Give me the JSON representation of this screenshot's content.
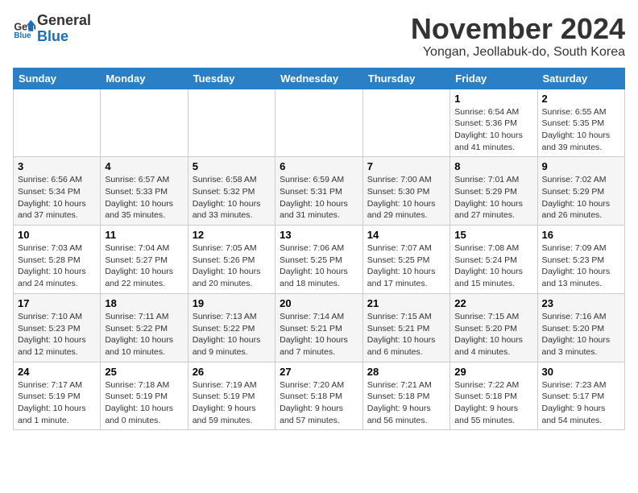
{
  "header": {
    "logo_line1": "General",
    "logo_line2": "Blue",
    "month_year": "November 2024",
    "location": "Yongan, Jeollabuk-do, South Korea"
  },
  "weekdays": [
    "Sunday",
    "Monday",
    "Tuesday",
    "Wednesday",
    "Thursday",
    "Friday",
    "Saturday"
  ],
  "weeks": [
    [
      {
        "day": "",
        "info": ""
      },
      {
        "day": "",
        "info": ""
      },
      {
        "day": "",
        "info": ""
      },
      {
        "day": "",
        "info": ""
      },
      {
        "day": "",
        "info": ""
      },
      {
        "day": "1",
        "info": "Sunrise: 6:54 AM\nSunset: 5:36 PM\nDaylight: 10 hours and 41 minutes."
      },
      {
        "day": "2",
        "info": "Sunrise: 6:55 AM\nSunset: 5:35 PM\nDaylight: 10 hours and 39 minutes."
      }
    ],
    [
      {
        "day": "3",
        "info": "Sunrise: 6:56 AM\nSunset: 5:34 PM\nDaylight: 10 hours and 37 minutes."
      },
      {
        "day": "4",
        "info": "Sunrise: 6:57 AM\nSunset: 5:33 PM\nDaylight: 10 hours and 35 minutes."
      },
      {
        "day": "5",
        "info": "Sunrise: 6:58 AM\nSunset: 5:32 PM\nDaylight: 10 hours and 33 minutes."
      },
      {
        "day": "6",
        "info": "Sunrise: 6:59 AM\nSunset: 5:31 PM\nDaylight: 10 hours and 31 minutes."
      },
      {
        "day": "7",
        "info": "Sunrise: 7:00 AM\nSunset: 5:30 PM\nDaylight: 10 hours and 29 minutes."
      },
      {
        "day": "8",
        "info": "Sunrise: 7:01 AM\nSunset: 5:29 PM\nDaylight: 10 hours and 27 minutes."
      },
      {
        "day": "9",
        "info": "Sunrise: 7:02 AM\nSunset: 5:29 PM\nDaylight: 10 hours and 26 minutes."
      }
    ],
    [
      {
        "day": "10",
        "info": "Sunrise: 7:03 AM\nSunset: 5:28 PM\nDaylight: 10 hours and 24 minutes."
      },
      {
        "day": "11",
        "info": "Sunrise: 7:04 AM\nSunset: 5:27 PM\nDaylight: 10 hours and 22 minutes."
      },
      {
        "day": "12",
        "info": "Sunrise: 7:05 AM\nSunset: 5:26 PM\nDaylight: 10 hours and 20 minutes."
      },
      {
        "day": "13",
        "info": "Sunrise: 7:06 AM\nSunset: 5:25 PM\nDaylight: 10 hours and 18 minutes."
      },
      {
        "day": "14",
        "info": "Sunrise: 7:07 AM\nSunset: 5:25 PM\nDaylight: 10 hours and 17 minutes."
      },
      {
        "day": "15",
        "info": "Sunrise: 7:08 AM\nSunset: 5:24 PM\nDaylight: 10 hours and 15 minutes."
      },
      {
        "day": "16",
        "info": "Sunrise: 7:09 AM\nSunset: 5:23 PM\nDaylight: 10 hours and 13 minutes."
      }
    ],
    [
      {
        "day": "17",
        "info": "Sunrise: 7:10 AM\nSunset: 5:23 PM\nDaylight: 10 hours and 12 minutes."
      },
      {
        "day": "18",
        "info": "Sunrise: 7:11 AM\nSunset: 5:22 PM\nDaylight: 10 hours and 10 minutes."
      },
      {
        "day": "19",
        "info": "Sunrise: 7:13 AM\nSunset: 5:22 PM\nDaylight: 10 hours and 9 minutes."
      },
      {
        "day": "20",
        "info": "Sunrise: 7:14 AM\nSunset: 5:21 PM\nDaylight: 10 hours and 7 minutes."
      },
      {
        "day": "21",
        "info": "Sunrise: 7:15 AM\nSunset: 5:21 PM\nDaylight: 10 hours and 6 minutes."
      },
      {
        "day": "22",
        "info": "Sunrise: 7:15 AM\nSunset: 5:20 PM\nDaylight: 10 hours and 4 minutes."
      },
      {
        "day": "23",
        "info": "Sunrise: 7:16 AM\nSunset: 5:20 PM\nDaylight: 10 hours and 3 minutes."
      }
    ],
    [
      {
        "day": "24",
        "info": "Sunrise: 7:17 AM\nSunset: 5:19 PM\nDaylight: 10 hours and 1 minute."
      },
      {
        "day": "25",
        "info": "Sunrise: 7:18 AM\nSunset: 5:19 PM\nDaylight: 10 hours and 0 minutes."
      },
      {
        "day": "26",
        "info": "Sunrise: 7:19 AM\nSunset: 5:19 PM\nDaylight: 9 hours and 59 minutes."
      },
      {
        "day": "27",
        "info": "Sunrise: 7:20 AM\nSunset: 5:18 PM\nDaylight: 9 hours and 57 minutes."
      },
      {
        "day": "28",
        "info": "Sunrise: 7:21 AM\nSunset: 5:18 PM\nDaylight: 9 hours and 56 minutes."
      },
      {
        "day": "29",
        "info": "Sunrise: 7:22 AM\nSunset: 5:18 PM\nDaylight: 9 hours and 55 minutes."
      },
      {
        "day": "30",
        "info": "Sunrise: 7:23 AM\nSunset: 5:17 PM\nDaylight: 9 hours and 54 minutes."
      }
    ]
  ]
}
